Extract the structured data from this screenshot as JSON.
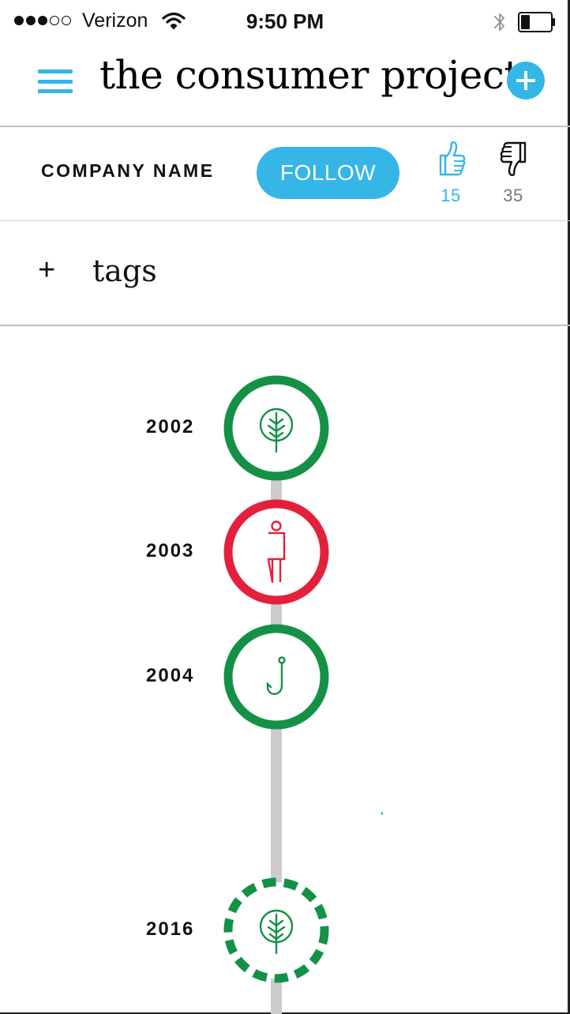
{
  "status_bar": {
    "carrier": "Verizon",
    "time": "9:50 PM",
    "signal_bars_filled": 3,
    "signal_bars_total": 5,
    "battery_level": 0.3
  },
  "header": {
    "title": "the consumer project",
    "menu_icon": "hamburger-menu-icon",
    "add_icon": "plus-circle-icon"
  },
  "company": {
    "name": "COMPANY NAME",
    "follow_label": "FOLLOW",
    "thumbs_up_count": "15",
    "thumbs_down_count": "35"
  },
  "tags": {
    "plus": "+",
    "label": "tags"
  },
  "timeline": [
    {
      "year": "2002",
      "icon": "tree-icon",
      "status": "positive",
      "color": "#149147"
    },
    {
      "year": "2003",
      "icon": "person-icon",
      "status": "negative",
      "color": "#e4213c"
    },
    {
      "year": "2004",
      "icon": "fish-hook-icon",
      "status": "positive",
      "color": "#149147"
    },
    {
      "year": "2016",
      "icon": "tree-icon",
      "status": "pending",
      "color": "#149147"
    }
  ],
  "colors": {
    "accent": "#35b6e6",
    "green": "#149147",
    "red": "#e4213c",
    "line": "#cccccc"
  }
}
